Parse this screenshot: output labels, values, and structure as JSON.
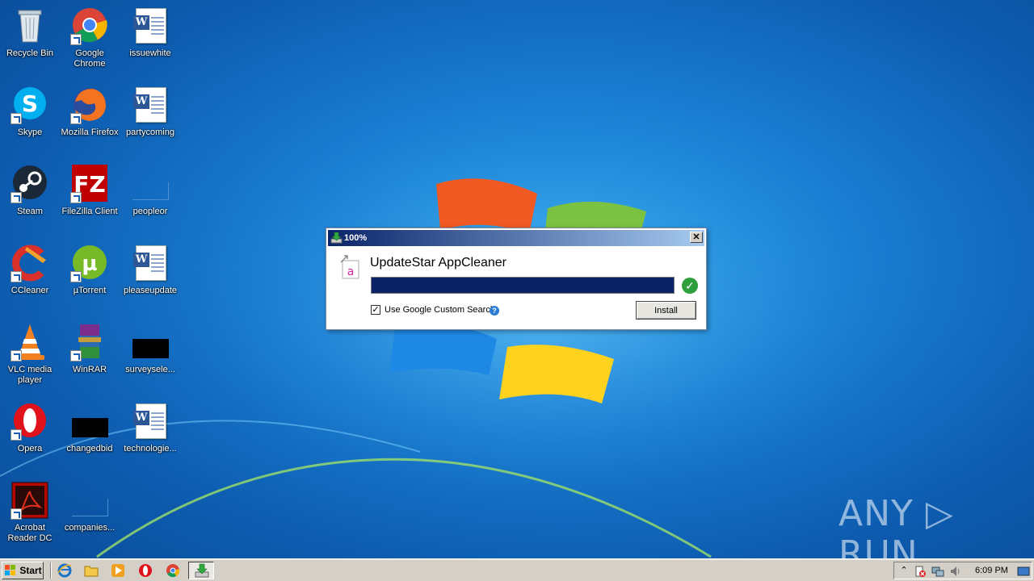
{
  "desktop": {
    "icons": [
      {
        "label": "Recycle Bin",
        "icon": "recycle-bin-icon"
      },
      {
        "label": "Google Chrome",
        "icon": "chrome-icon"
      },
      {
        "label": "issuewhite",
        "icon": "word-document-icon"
      },
      {
        "label": "Skype",
        "icon": "skype-icon"
      },
      {
        "label": "Mozilla Firefox",
        "icon": "firefox-icon"
      },
      {
        "label": "partycoming",
        "icon": "word-document-icon"
      },
      {
        "label": "Steam",
        "icon": "steam-icon"
      },
      {
        "label": "FileZilla Client",
        "icon": "filezilla-icon"
      },
      {
        "label": "peopleor",
        "icon": "blank-file-icon"
      },
      {
        "label": "CCleaner",
        "icon": "ccleaner-icon"
      },
      {
        "label": "µTorrent",
        "icon": "utorrent-icon"
      },
      {
        "label": "pleaseupdate",
        "icon": "word-document-icon"
      },
      {
        "label": "VLC media player",
        "icon": "vlc-icon"
      },
      {
        "label": "WinRAR",
        "icon": "winrar-icon"
      },
      {
        "label": "surveysele...",
        "icon": "black-file-icon"
      },
      {
        "label": "Opera",
        "icon": "opera-icon"
      },
      {
        "label": "changedbid",
        "icon": "black-file-icon"
      },
      {
        "label": "technologie...",
        "icon": "word-document-icon"
      },
      {
        "label": "Acrobat Reader DC",
        "icon": "acrobat-icon"
      },
      {
        "label": "companies...",
        "icon": "blank-file-icon"
      }
    ]
  },
  "dialog": {
    "title": "100%",
    "app_name": "UpdateStar AppCleaner",
    "progress": 1.0,
    "checkbox_label": "Use Google Custom Search",
    "checkbox_checked": true,
    "install_label": "Install",
    "close_label": "✕"
  },
  "watermark": "ANY ▷ RUN",
  "taskbar": {
    "start_label": "Start",
    "clock": "6:09 PM"
  },
  "colors": {
    "titlebar_start": "#0a246a",
    "progress_fill": "#0c2266",
    "check_green": "#2f9e3c"
  }
}
